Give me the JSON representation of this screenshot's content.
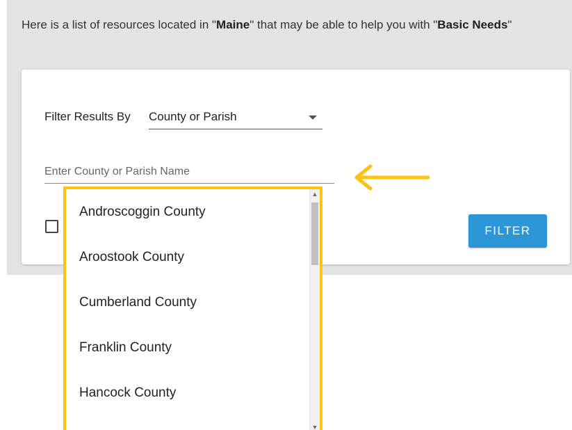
{
  "intro": {
    "prefix": "Here is a list of resources located in \"",
    "location": "Maine",
    "middle": "\" that may be able to help you with \"",
    "category": "Basic Needs",
    "suffix": "\""
  },
  "filter": {
    "label": "Filter Results By",
    "selected": "County or Parish"
  },
  "county_input": {
    "placeholder": "Enter County or Parish Name",
    "value": ""
  },
  "filter_button": {
    "label": "FILTER"
  },
  "dropdown": {
    "items": [
      "Androscoggin County",
      "Aroostook County",
      "Cumberland County",
      "Franklin County",
      "Hancock County"
    ]
  },
  "colors": {
    "highlight": "#ffc20e",
    "button": "#2d96d6",
    "band": "#e3e3e3"
  },
  "icons": {
    "arrow": "arrow-left-icon",
    "caret": "caret-down-icon"
  }
}
